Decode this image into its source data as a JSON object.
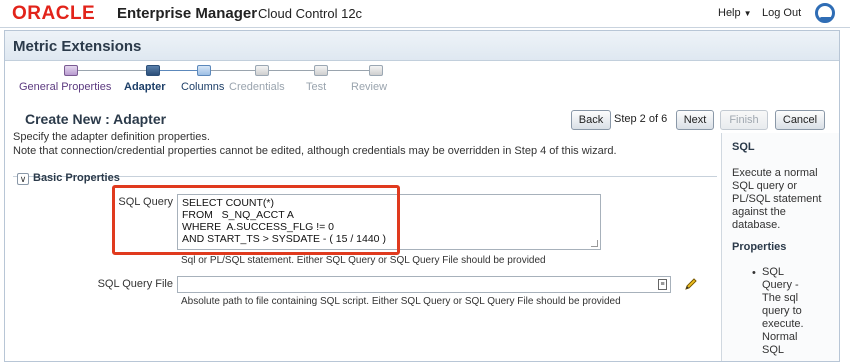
{
  "header": {
    "logo": "ORACLE",
    "product": "Enterprise Manager",
    "edition": "Cloud Control 12c",
    "help_label": "Help",
    "help_caret": "▼",
    "logout_label": "Log Out"
  },
  "page": {
    "title": "Metric Extensions"
  },
  "train": {
    "steps": [
      {
        "label": "General Properties",
        "state": "visited"
      },
      {
        "label": "Adapter",
        "state": "current"
      },
      {
        "label": "Columns",
        "state": "next"
      },
      {
        "label": "Credentials",
        "state": "disabled"
      },
      {
        "label": "Test",
        "state": "disabled"
      },
      {
        "label": "Review",
        "state": "disabled"
      }
    ]
  },
  "wizard": {
    "heading": "Create New : Adapter",
    "back_label": "Back",
    "step_text": "Step 2 of 6",
    "next_label": "Next",
    "finish_label": "Finish",
    "cancel_label": "Cancel",
    "description_line1": "Specify the adapter definition properties.",
    "description_line2": "Note that connection/credential properties cannot be edited, although credentials may be overridden in Step 4 of this wizard."
  },
  "basic_properties": {
    "section_title": "Basic Properties",
    "toggle_symbol": "∨",
    "sql_query_label": "SQL Query",
    "sql_query_lines": [
      "SELECT COUNT(*)",
      "FROM   S_NQ_ACCT A",
      "WHERE  A.SUCCESS_FLG != 0",
      "AND START_TS > SYSDATE - ( 15 / 1440 )"
    ],
    "sql_query_hint": "Sql or PL/SQL statement. Either SQL Query or SQL Query File should be provided",
    "sql_query_file_label": "SQL Query File",
    "sql_query_file_value": "",
    "sql_query_file_hint": "Absolute path to file containing SQL script. Either SQL Query or SQL Query File should be provided",
    "file_icon_glyph": "≡"
  },
  "help_panel": {
    "title": "SQL",
    "text_lines": [
      "Execute a normal",
      "SQL query or",
      "PL/SQL statement",
      "against the",
      "database."
    ],
    "properties_title": "Properties",
    "bullet": "•",
    "item_lines": [
      "SQL",
      "Query -",
      "The sql",
      "query to",
      "execute.",
      "Normal",
      "SQL"
    ]
  },
  "colors": {
    "brand_red": "#e2231a",
    "highlight_box": "#e03a1e",
    "accent_blue": "#2f6db5"
  }
}
